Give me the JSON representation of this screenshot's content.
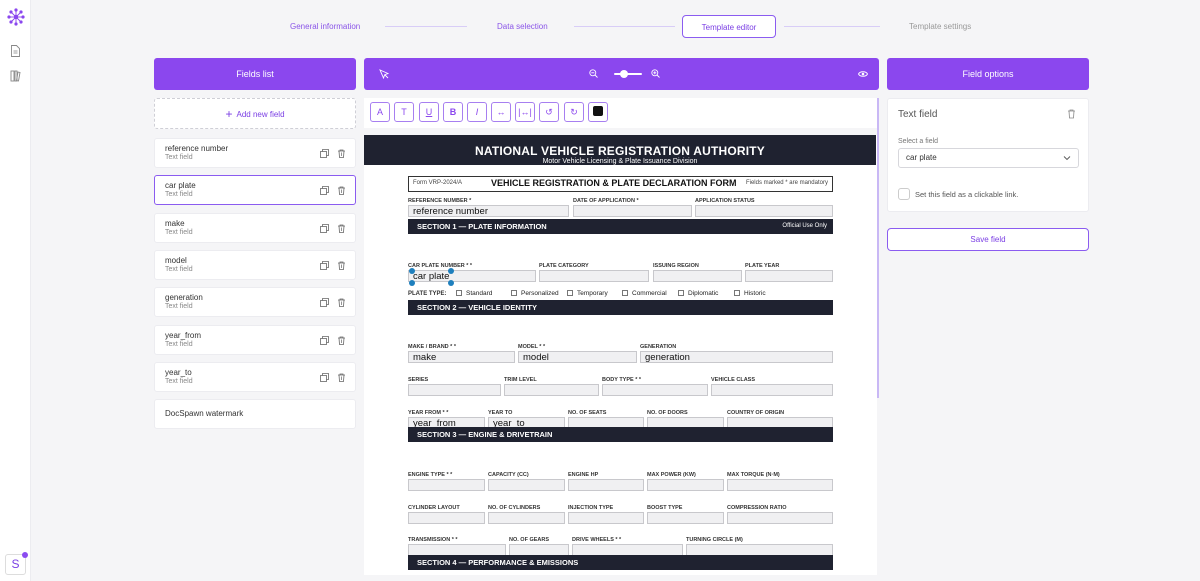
{
  "steps": [
    {
      "label": "General information"
    },
    {
      "label": "Data selection"
    },
    {
      "label": "Template editor"
    },
    {
      "label": "Template settings"
    }
  ],
  "panels": {
    "fields_title": "Fields list",
    "options_title": "Field options"
  },
  "fields": {
    "add_label": "Add new field",
    "items": [
      {
        "name": "reference number",
        "type": "Text field"
      },
      {
        "name": "car plate",
        "type": "Text field"
      },
      {
        "name": "make",
        "type": "Text field"
      },
      {
        "name": "model",
        "type": "Text field"
      },
      {
        "name": "generation",
        "type": "Text field"
      },
      {
        "name": "year_from",
        "type": "Text field"
      },
      {
        "name": "year_to",
        "type": "Text field"
      }
    ],
    "watermark": "DocSpawn watermark"
  },
  "options": {
    "title": "Text field",
    "select_label": "Select a field",
    "selected": "car plate",
    "checkbox_label": "Set this field as a clickable link.",
    "save": "Save field"
  },
  "user": {
    "initial": "S"
  },
  "zoom": {
    "value_percent": 30
  },
  "doc": {
    "title": "NATIONAL VEHICLE REGISTRATION AUTHORITY",
    "subtitle": "Motor Vehicle Licensing & Plate Issuance Division",
    "form_id": "Form VRP-2024/A",
    "form_title": "VEHICLE REGISTRATION & PLATE DECLARATION FORM",
    "form_note": "Fields marked * are mandatory",
    "labels": {
      "ref": "REFERENCE NUMBER *",
      "date": "DATE OF APPLICATION *",
      "status": "APPLICATION STATUS",
      "plate": "CAR PLATE NUMBER * *",
      "plate_cat": "PLATE CATEGORY",
      "region": "ISSUING REGION",
      "plate_year": "PLATE YEAR",
      "plate_type": "PLATE TYPE:",
      "make": "MAKE / BRAND * *",
      "model": "MODEL * *",
      "generation": "GENERATION",
      "series": "SERIES",
      "trim": "TRIM LEVEL",
      "body": "BODY TYPE * *",
      "vclass": "VEHICLE CLASS",
      "year_from": "YEAR FROM * *",
      "year_to": "YEAR TO",
      "seats": "NO. OF SEATS",
      "doors": "NO. OF DOORS",
      "origin": "COUNTRY OF ORIGIN",
      "engine": "ENGINE TYPE * *",
      "capacity": "CAPACITY (CC)",
      "hp": "ENGINE HP",
      "power": "MAX POWER (KW)",
      "torque": "MAX TORQUE (N·M)",
      "cyl_layout": "CYLINDER LAYOUT",
      "cyls": "NO. OF CYLINDERS",
      "injection": "INJECTION TYPE",
      "boost": "BOOST TYPE",
      "compression": "COMPRESSION RATIO",
      "transmission": "TRANSMISSION * *",
      "gears": "NO. OF GEARS",
      "drive": "DRIVE WHEELS * *",
      "turning": "TURNING CIRCLE (M)"
    },
    "plate_types": [
      "Standard",
      "Personalized",
      "Temporary",
      "Commercial",
      "Diplomatic",
      "Historic"
    ],
    "sections": {
      "s1": "SECTION 1 — PLATE INFORMATION",
      "s1_note": "Official Use Only",
      "s2": "SECTION 2 — VEHICLE IDENTITY",
      "s3": "SECTION 3 — ENGINE & DRIVETRAIN",
      "s4": "SECTION 4 — PERFORMANCE & EMISSIONS"
    },
    "values": {
      "ref": "reference number",
      "plate": "car plate",
      "make": "make",
      "model": "model",
      "generation": "generation",
      "year_from": "year_from",
      "year_to": "year_to"
    }
  }
}
